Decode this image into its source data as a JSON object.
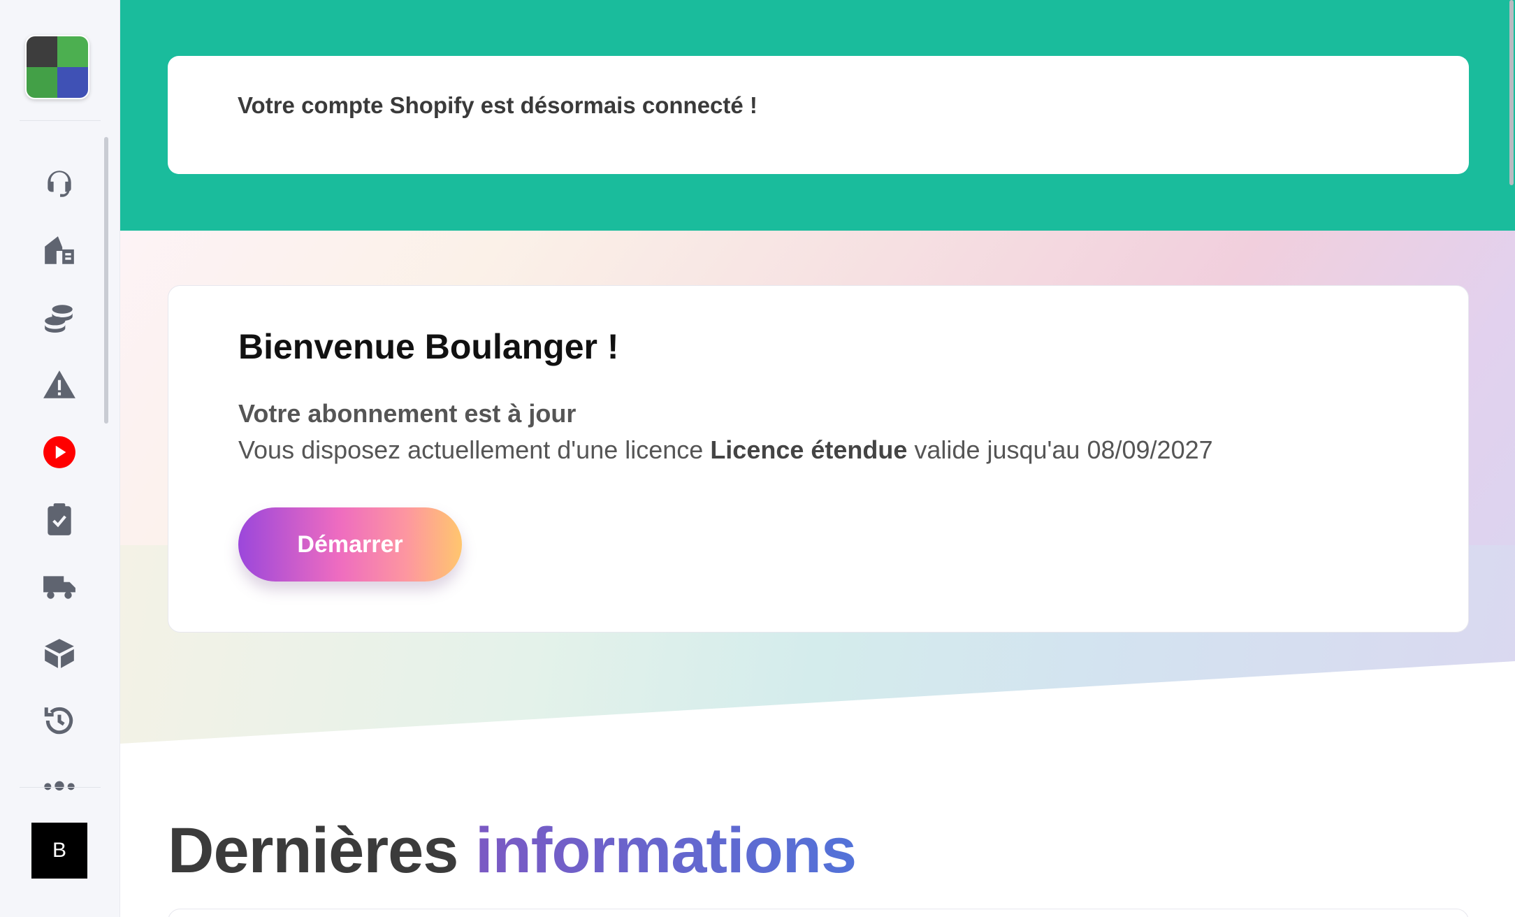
{
  "app": {
    "logo_colors": [
      "#3d3d3d",
      "#4caf50",
      "#43a047",
      "#3f51b5"
    ],
    "user_initial": "B"
  },
  "sidebar": {
    "items": [
      {
        "icon": "headset-icon",
        "name": "support"
      },
      {
        "icon": "store-icon",
        "name": "store"
      },
      {
        "icon": "coins-icon",
        "name": "coins"
      },
      {
        "icon": "warning-icon",
        "name": "alerts"
      },
      {
        "icon": "youtube-icon",
        "name": "videos"
      },
      {
        "icon": "clipboard-check-icon",
        "name": "tasks"
      },
      {
        "icon": "truck-icon",
        "name": "shipping"
      },
      {
        "icon": "box-icon",
        "name": "products"
      },
      {
        "icon": "history-icon",
        "name": "history"
      },
      {
        "icon": "more-icon",
        "name": "more"
      }
    ]
  },
  "notice": {
    "text": "Votre compte Shopify est désormais connecté !"
  },
  "welcome": {
    "title": "Bienvenue Boulanger !",
    "subtitle": "Votre abonnement est à jour",
    "line_prefix": "Vous disposez actuellement d'une licence ",
    "license_name": "Licence étendue",
    "line_suffix": " valide jusqu'au 08/09/2027",
    "start_label": "Démarrer"
  },
  "news": {
    "title_part1": "Dernières ",
    "title_part2": "informations"
  },
  "colors": {
    "topband": "#1abc9c",
    "accent": "#5a6ad4",
    "youtube": "#ff0000",
    "icon": "#5f6470"
  }
}
